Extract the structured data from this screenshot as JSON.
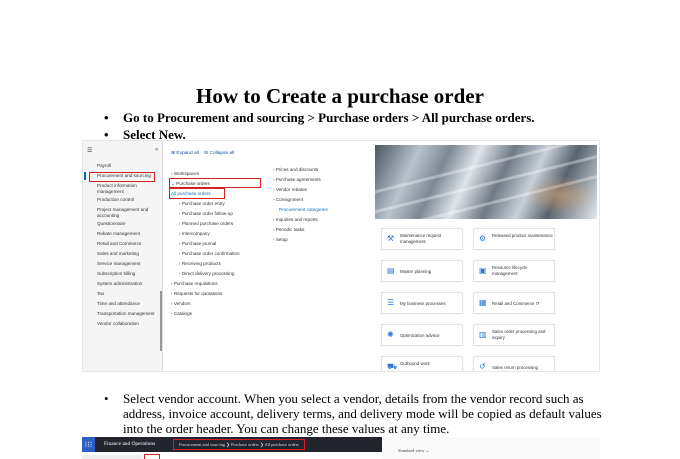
{
  "document": {
    "title": "How to Create a purchase order",
    "steps": [
      "Go to Procurement and sourcing > Purchase orders > All purchase orders.",
      "Select New."
    ],
    "paragraph": "Select vendor account. When you select a vendor, details from the vendor record such as address, invoice account, delivery terms, and delivery mode will be copied as default values into the order header. You can change these values at any time."
  },
  "screenshot1": {
    "menu_items": [
      "Payroll",
      "Procurement and sourcing",
      "Product information management",
      "Production control",
      "Project management and accounting",
      "Questionnaire",
      "Rebate management",
      "Retail and Commerce",
      "Sales and marketing",
      "Service management",
      "Subscription billing",
      "System administration",
      "Tax",
      "Time and attendance",
      "Transportation management",
      "Vendor collaboration"
    ],
    "expand_all": "Expand all",
    "collapse_all": "Collapse all",
    "column2": [
      "Workspaces",
      "Purchase orders",
      "All purchase orders",
      "Purchase order entry",
      "Purchase order follow-up",
      "Planned purchase orders",
      "Intercompany",
      "Purchase journal",
      "Purchase order confirmation",
      "Receiving products",
      "Direct delivery processing",
      "Purchase requisitions",
      "Requests for quotations",
      "Vendors",
      "Catalogs"
    ],
    "column3": [
      "Prices and discounts",
      "Purchase agreements",
      "Vendor rebates",
      "Consignment",
      "Procurement categories",
      "Inquiries and reports",
      "Periodic tasks",
      "Setup"
    ],
    "tiles": [
      {
        "label": "Maintenance request management",
        "icon": "wrench-icon"
      },
      {
        "label": "Released product maintenance",
        "icon": "product-icon"
      },
      {
        "label": "Master planning",
        "icon": "planning-icon"
      },
      {
        "label": "Resource lifecycle management",
        "icon": "lifecycle-icon"
      },
      {
        "label": "My business processes",
        "icon": "list-icon"
      },
      {
        "label": "Retail and Commerce IT",
        "icon": "store-icon"
      },
      {
        "label": "Optimization advisor",
        "icon": "gear-icon"
      },
      {
        "label": "Sales order processing and inquiry",
        "icon": "order-icon"
      },
      {
        "label": "Outbound work",
        "icon": "truck-icon"
      },
      {
        "label": "Sales return processing",
        "icon": "return-icon"
      }
    ]
  },
  "screenshot2": {
    "app_name": "Finance and Operations",
    "breadcrumb": "Procurement and sourcing  ❯  Purchase orders  ❯  All purchase orders",
    "view_label": "Standard view ⌄"
  }
}
